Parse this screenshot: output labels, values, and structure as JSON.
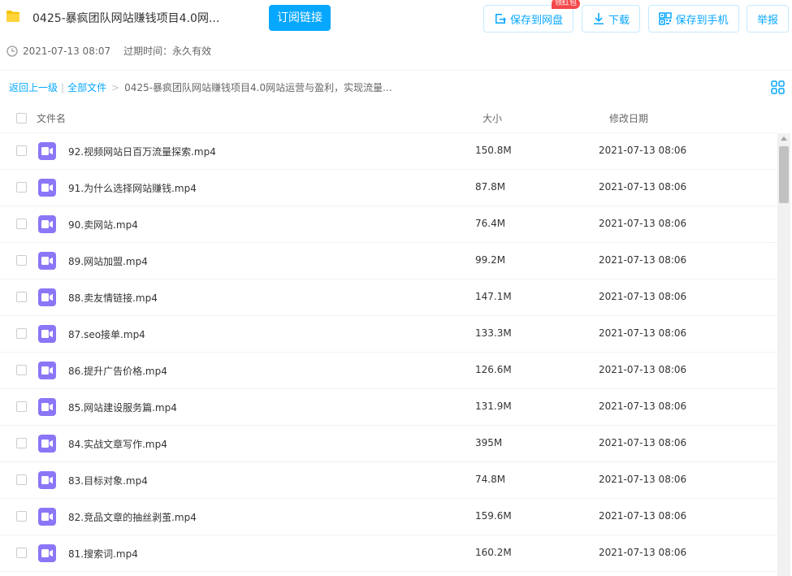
{
  "header": {
    "title": "0425-暴疯团队网站赚钱项目4.0网...",
    "subscribe_label": "订阅链接",
    "save_label": "保存到网盘",
    "redpack_badge": "领红包",
    "download_label": "下载",
    "phone_label": "保存到手机",
    "report_label": "举报"
  },
  "meta": {
    "share_time": "2021-07-13 08:07",
    "expire_text": "过期时间：永久有效"
  },
  "breadcrumb": {
    "back": "返回上一级",
    "all_files": "全部文件",
    "current": "0425-暴疯团队网站赚钱项目4.0网站运营与盈利，实现流量..."
  },
  "columns": {
    "name": "文件名",
    "size": "大小",
    "date": "修改日期"
  },
  "files": [
    {
      "name": "92.视频网站日百万流量探索.mp4",
      "size": "150.8M",
      "date": "2021-07-13 08:06"
    },
    {
      "name": "91.为什么选择网站赚钱.mp4",
      "size": "87.8M",
      "date": "2021-07-13 08:06"
    },
    {
      "name": "90.卖网站.mp4",
      "size": "76.4M",
      "date": "2021-07-13 08:06"
    },
    {
      "name": "89.网站加盟.mp4",
      "size": "99.2M",
      "date": "2021-07-13 08:06"
    },
    {
      "name": "88.卖友情链接.mp4",
      "size": "147.1M",
      "date": "2021-07-13 08:06"
    },
    {
      "name": "87.seo接单.mp4",
      "size": "133.3M",
      "date": "2021-07-13 08:06"
    },
    {
      "name": "86.提升广告价格.mp4",
      "size": "126.6M",
      "date": "2021-07-13 08:06"
    },
    {
      "name": "85.网站建设服务篇.mp4",
      "size": "131.9M",
      "date": "2021-07-13 08:06"
    },
    {
      "name": "84.实战文章写作.mp4",
      "size": "395M",
      "date": "2021-07-13 08:06"
    },
    {
      "name": "83.目标对象.mp4",
      "size": "74.8M",
      "date": "2021-07-13 08:06"
    },
    {
      "name": "82.竞品文章的抽丝剥茧.mp4",
      "size": "159.6M",
      "date": "2021-07-13 08:06"
    },
    {
      "name": "81.搜索词.mp4",
      "size": "160.2M",
      "date": "2021-07-13 08:06"
    }
  ],
  "colors": {
    "accent": "#06a7ff",
    "video_icon": "#8b76f7",
    "folder": "#f5c400",
    "badge": "#f5484b"
  },
  "icons": {
    "folder": "folder-icon",
    "save": "save-to-disk-icon",
    "download": "download-icon",
    "phone": "qr-phone-icon",
    "clock": "clock-icon",
    "grid": "grid-view-icon",
    "video": "video-file-icon"
  }
}
